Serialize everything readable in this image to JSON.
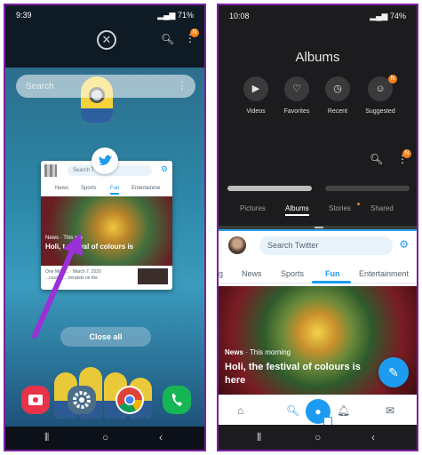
{
  "colors": {
    "frame": "#7b1fa2",
    "twitter_blue": "#1d9bf0",
    "badge_orange": "#f7821b"
  },
  "left": {
    "status": {
      "time": "9:39",
      "battery": "71%"
    },
    "search": {
      "placeholder": "Search"
    },
    "card": {
      "search_text": "Search T",
      "tabs": [
        "News",
        "Sports",
        "Fun",
        "Entertainme"
      ],
      "meta": "News · This mo",
      "headline": "Holi, t    estival of colours is",
      "footer_date": "One Morn... · March 7, 2020",
      "footer_text": "...cussed ...neratets on the"
    },
    "close_all": "Close all",
    "badge": "N"
  },
  "right": {
    "status": {
      "time": "10:08",
      "battery": "74%"
    },
    "albums": {
      "title": "Albums",
      "categories": [
        {
          "label": "Videos",
          "icon": "video-icon"
        },
        {
          "label": "Favorites",
          "icon": "heart-icon"
        },
        {
          "label": "Recent",
          "icon": "clock-icon"
        },
        {
          "label": "Suggested",
          "icon": "suggested-icon"
        }
      ],
      "tabs": [
        "Pictures",
        "Albums",
        "Stories",
        "Shared"
      ],
      "badge": "N"
    },
    "twitter": {
      "search_placeholder": "Search Twitter",
      "tabs": [
        "g",
        "News",
        "Sports",
        "Fun",
        "Entertainment"
      ],
      "meta_prefix": "News",
      "meta_suffix": " · This morning",
      "headline": "Holi, the festival of colours is here"
    }
  }
}
